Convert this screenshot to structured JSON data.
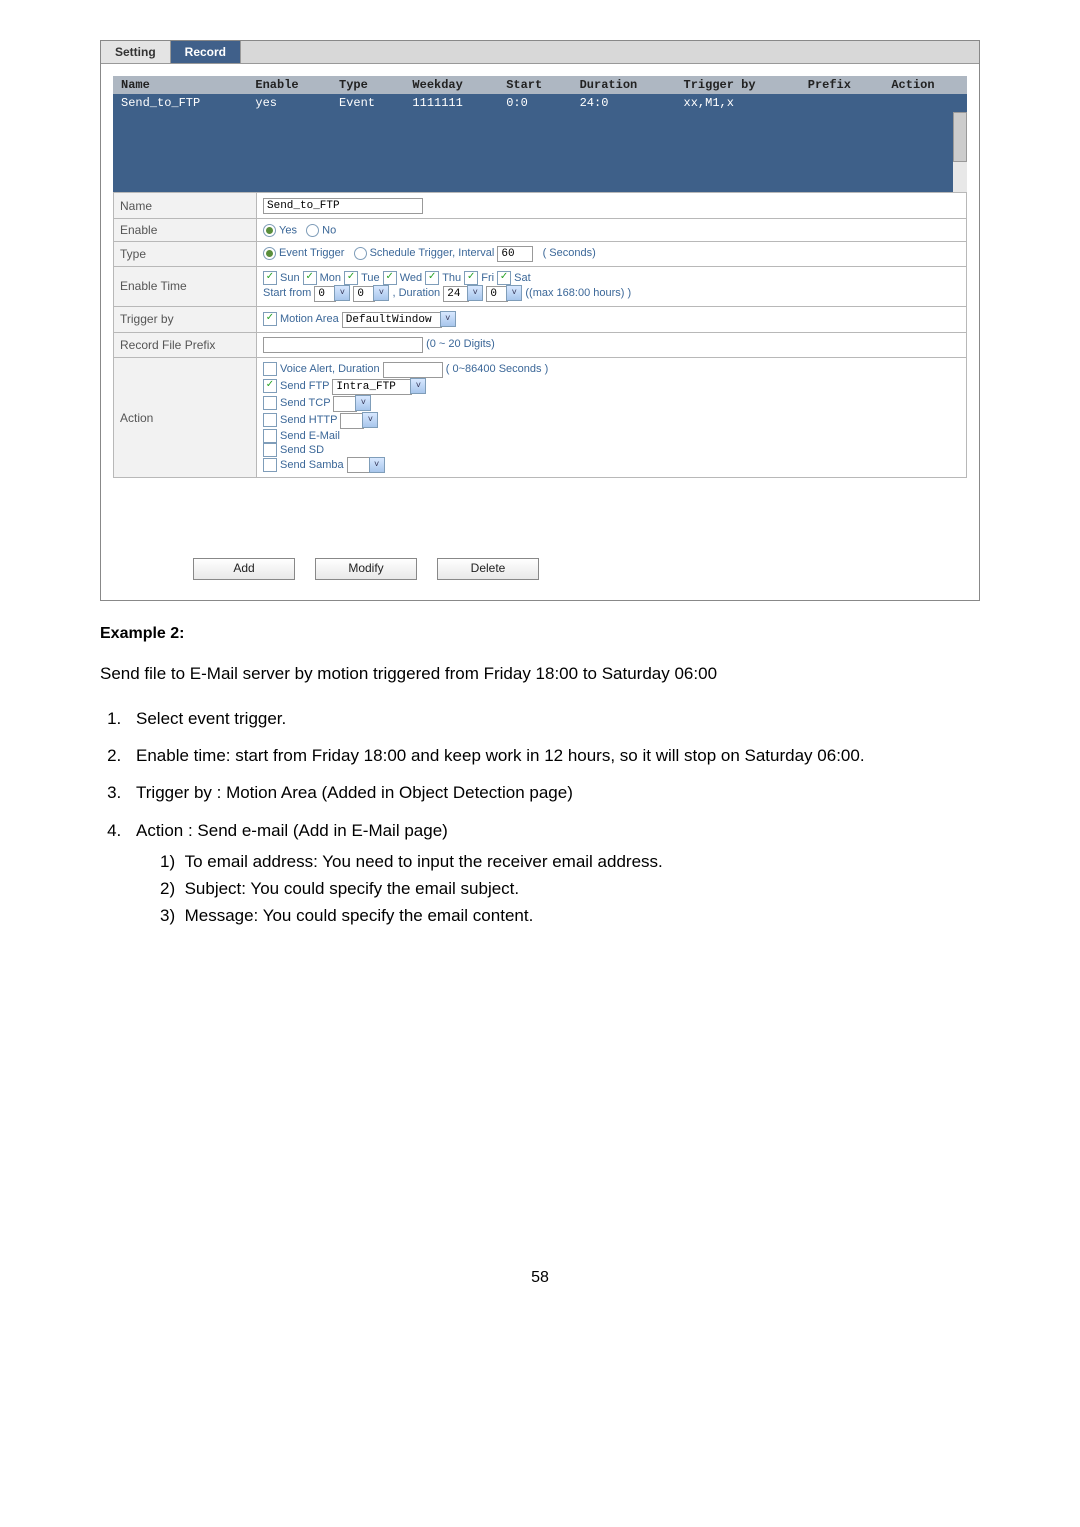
{
  "tabs": {
    "setting": "Setting",
    "record": "Record"
  },
  "columns": {
    "name": "Name",
    "enable": "Enable",
    "type": "Type",
    "weekday": "Weekday",
    "start": "Start",
    "duration": "Duration",
    "trigger_by": "Trigger by",
    "prefix": "Prefix",
    "action": "Action"
  },
  "row": {
    "name": "Send_to_FTP",
    "enable": "yes",
    "type": "Event",
    "weekday": "1111111",
    "start": "0:0",
    "duration": "24:0",
    "trigger_by": "xx,M1,x",
    "prefix": "",
    "action": ""
  },
  "form": {
    "label_name": "Name",
    "label_enable": "Enable",
    "label_type": "Type",
    "label_enable_time": "Enable Time",
    "label_trigger_by": "Trigger by",
    "label_prefix": "Record File Prefix",
    "label_action": "Action",
    "name_value": "Send_to_FTP",
    "enable_yes": "Yes",
    "enable_no": "No",
    "type_event_trigger": "Event Trigger",
    "type_schedule_trigger": "Schedule Trigger, Interval",
    "type_interval_value": "60",
    "type_seconds_label": "( Seconds)",
    "days": {
      "sun": "Sun",
      "mon": "Mon",
      "tue": "Tue",
      "wed": "Wed",
      "thu": "Thu",
      "fri": "Fri",
      "sat": "Sat"
    },
    "start_from_label": "Start from",
    "start_h": "0",
    "start_m": "0",
    "duration_label": ", Duration",
    "dur_h": "24",
    "dur_m": "0",
    "max_label": "((max 168:00 hours) )",
    "trigger_motion": "Motion Area",
    "trigger_motion_value": "DefaultWindow",
    "prefix_hint": "(0 ~ 20 Digits)",
    "action_voice": "Voice Alert, Duration",
    "action_voice_hint": "( 0~86400 Seconds )",
    "action_ftp": "Send FTP",
    "action_ftp_value": "Intra_FTP",
    "action_tcp": "Send TCP",
    "action_http": "Send HTTP",
    "action_email": "Send E-Mail",
    "action_sd": "Send SD",
    "action_samba": "Send Samba"
  },
  "buttons": {
    "add": "Add",
    "modify": "Modify",
    "delete": "Delete"
  },
  "doc": {
    "heading": "Example 2:",
    "intro": "Send file to E-Mail server by motion triggered from Friday 18:00 to Saturday 06:00",
    "steps": {
      "s1": "Select event trigger.",
      "s2": "Enable time: start from Friday 18:00 and keep work in 12 hours, so it will stop on Saturday 06:00.",
      "s3": "Trigger by : Motion Area (Added in Object Detection page)",
      "s4": "Action : Send e-mail (Add in E-Mail page)",
      "sub1_num": "1)",
      "sub1_text": "To email address: You need to input the receiver email address.",
      "sub2_num": "2)",
      "sub2_text": "Subject: You could specify the email subject.",
      "sub3_num": "3)",
      "sub3_text": "Message: You could specify the email content."
    },
    "page_number": "58"
  }
}
